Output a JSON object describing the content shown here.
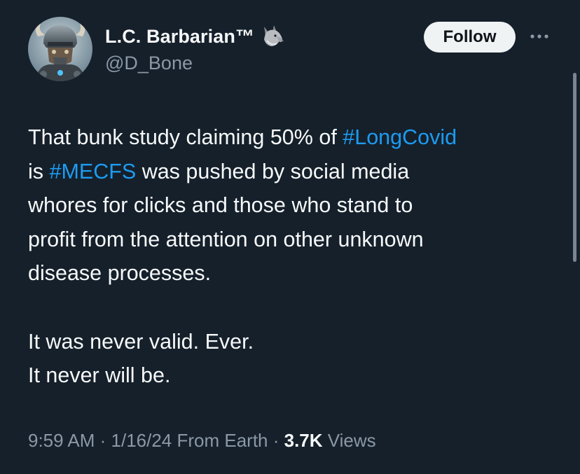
{
  "author": {
    "display_name": "L.C. Barbarian™",
    "handle": "@D_Bone",
    "badge_icon": "wolf-emoji-icon",
    "avatar_icon": "armored-warrior-avatar"
  },
  "actions": {
    "follow_label": "Follow",
    "more_icon": "more-horizontal-icon"
  },
  "tweet": {
    "line1_prefix": "That bunk study claiming 50% of ",
    "hashtag1": "#LongCovid",
    "line2_prefix": "is ",
    "hashtag2": "#MECFS",
    "line2_suffix": " was pushed by social media",
    "line3": "whores for clicks and those who stand to",
    "line4": "profit from the attention on other unknown",
    "line5": "disease processes.",
    "line6": "It was never valid. Ever.",
    "line7": "It never will be."
  },
  "meta": {
    "time": "9:59 AM",
    "sep1": " · ",
    "date": "1/16/24",
    "location": " From Earth",
    "sep2": " · ",
    "views_count": "3.7K",
    "views_label": " Views"
  },
  "colors": {
    "background": "#15202b",
    "text": "#f7f9f9",
    "secondary": "#8b98a5",
    "hashtag": "#1d9bf0",
    "follow_bg": "#eff3f4"
  }
}
